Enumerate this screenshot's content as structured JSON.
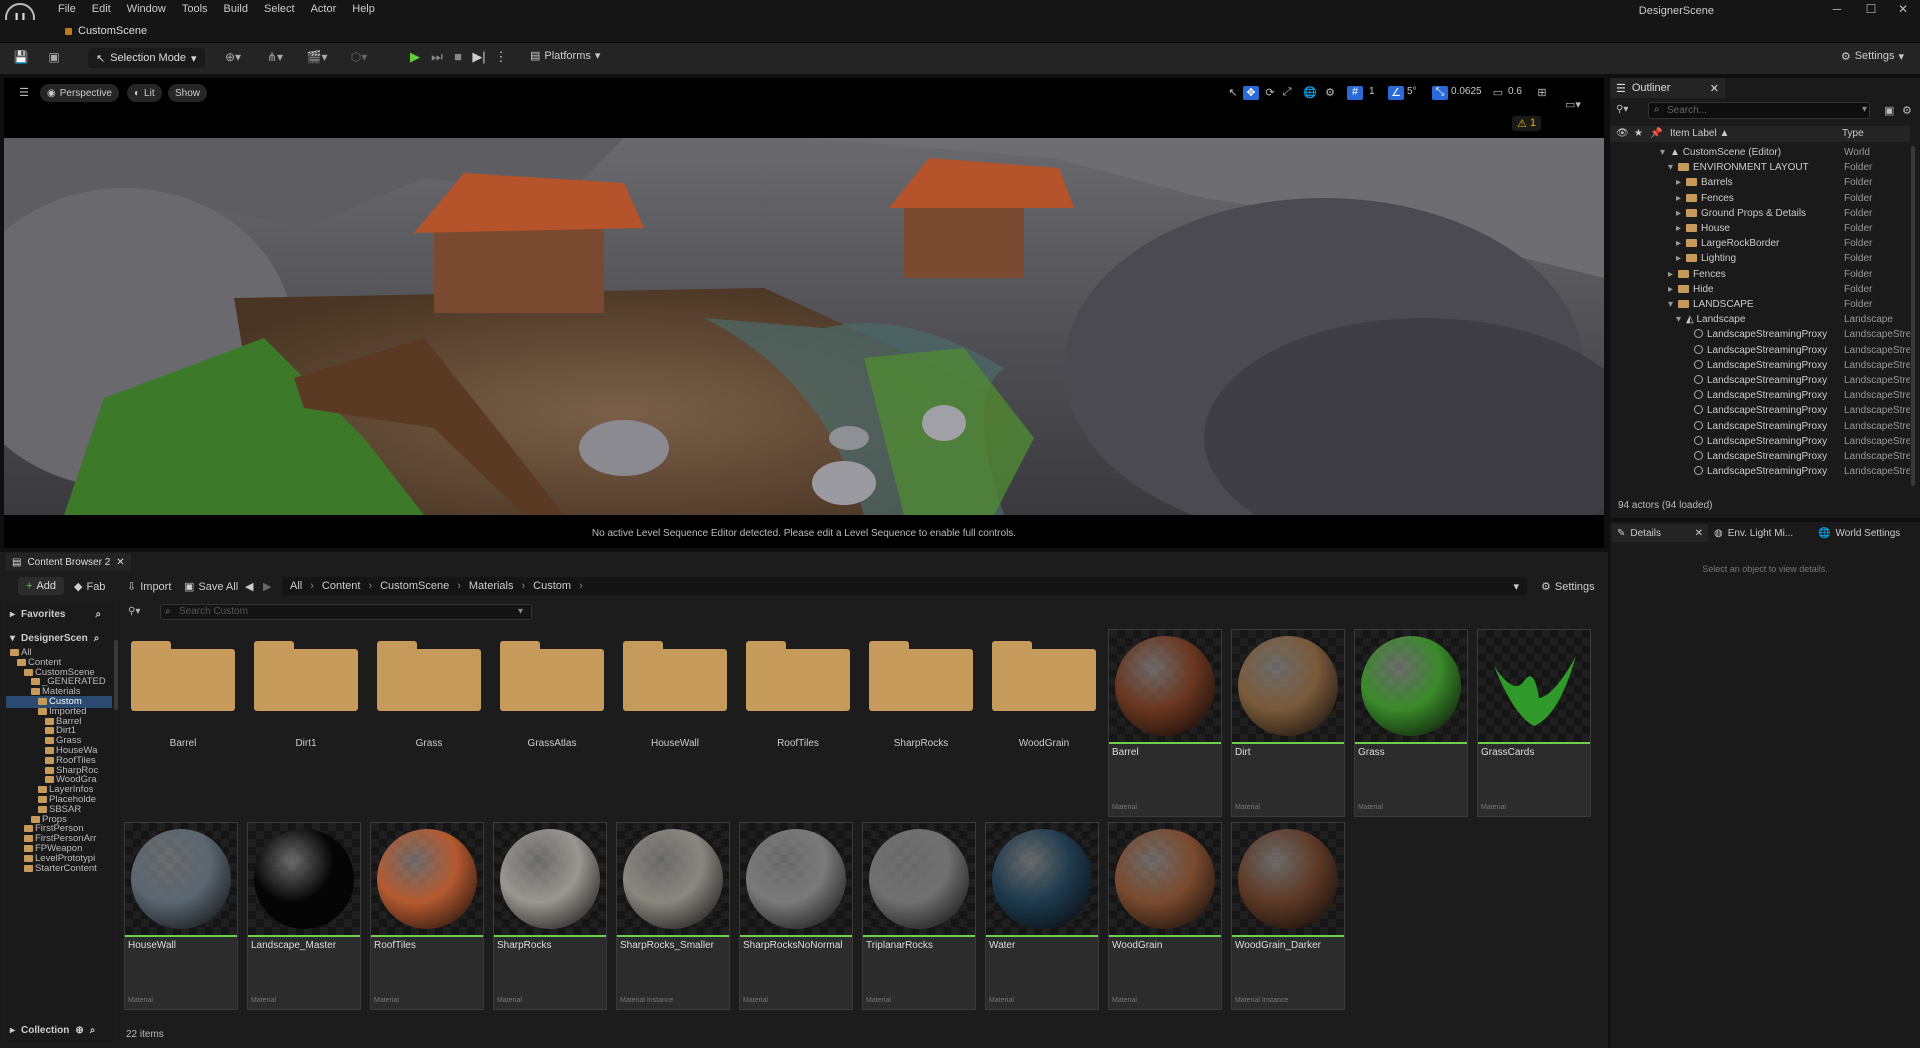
{
  "app": {
    "window_title": "DesignerScene",
    "doc_tab": "CustomScene",
    "menu": [
      "File",
      "Edit",
      "Window",
      "Tools",
      "Build",
      "Select",
      "Actor",
      "Help"
    ]
  },
  "toolbar": {
    "selection_mode": "Selection Mode",
    "platforms": "Platforms",
    "settings": "Settings"
  },
  "viewport": {
    "perspective": "Perspective",
    "lit": "Lit",
    "show": "Show",
    "grid_value": "1",
    "angle_value": "5°",
    "scale_value": "0.0625",
    "camera_speed": "0.6",
    "warning_count": "1",
    "sequence_message": "No active Level Sequence Editor detected. Please edit a Level Sequence to enable full controls."
  },
  "outliner": {
    "tab": "Outliner",
    "search_placeholder": "Search...",
    "col_label": "Item Label ▲",
    "col_type": "Type",
    "rows": [
      {
        "label": "CustomScene (Editor)",
        "type": "World",
        "indent": 0,
        "kind": "world"
      },
      {
        "label": "ENVIRONMENT LAYOUT",
        "type": "Folder",
        "indent": 1,
        "kind": "folder"
      },
      {
        "label": "Barrels",
        "type": "Folder",
        "indent": 2,
        "kind": "folder"
      },
      {
        "label": "Fences",
        "type": "Folder",
        "indent": 2,
        "kind": "folder"
      },
      {
        "label": "Ground Props & Details",
        "type": "Folder",
        "indent": 2,
        "kind": "folder"
      },
      {
        "label": "House",
        "type": "Folder",
        "indent": 2,
        "kind": "folder"
      },
      {
        "label": "LargeRockBorder",
        "type": "Folder",
        "indent": 2,
        "kind": "folder"
      },
      {
        "label": "Lighting",
        "type": "Folder",
        "indent": 2,
        "kind": "folder"
      },
      {
        "label": "Fences",
        "type": "Folder",
        "indent": 1,
        "kind": "folder"
      },
      {
        "label": "Hide",
        "type": "Folder",
        "indent": 1,
        "kind": "folder"
      },
      {
        "label": "LANDSCAPE",
        "type": "Folder",
        "indent": 1,
        "kind": "folder"
      },
      {
        "label": "Landscape",
        "type": "Landscape",
        "indent": 2,
        "kind": "landscape"
      },
      {
        "label": "LandscapeStreamingProxy",
        "type": "LandscapeStre",
        "indent": 3,
        "kind": "proxy"
      },
      {
        "label": "LandscapeStreamingProxy",
        "type": "LandscapeStre",
        "indent": 3,
        "kind": "proxy"
      },
      {
        "label": "LandscapeStreamingProxy",
        "type": "LandscapeStre",
        "indent": 3,
        "kind": "proxy"
      },
      {
        "label": "LandscapeStreamingProxy",
        "type": "LandscapeStre",
        "indent": 3,
        "kind": "proxy"
      },
      {
        "label": "LandscapeStreamingProxy",
        "type": "LandscapeStre",
        "indent": 3,
        "kind": "proxy"
      },
      {
        "label": "LandscapeStreamingProxy",
        "type": "LandscapeStre",
        "indent": 3,
        "kind": "proxy"
      },
      {
        "label": "LandscapeStreamingProxy",
        "type": "LandscapeStre",
        "indent": 3,
        "kind": "proxy"
      },
      {
        "label": "LandscapeStreamingProxy",
        "type": "LandscapeStre",
        "indent": 3,
        "kind": "proxy"
      },
      {
        "label": "LandscapeStreamingProxy",
        "type": "LandscapeStre",
        "indent": 3,
        "kind": "proxy"
      },
      {
        "label": "LandscapeStreamingProxy",
        "type": "LandscapeStre",
        "indent": 3,
        "kind": "proxy"
      }
    ],
    "actor_count": "94 actors (94 loaded)"
  },
  "details": {
    "tabs": [
      "Details",
      "Env. Light Mi...",
      "World Settings"
    ],
    "empty_message": "Select an object to view details."
  },
  "content_browser": {
    "tab": "Content Browser 2",
    "add": "Add",
    "fab": "Fab",
    "import": "Import",
    "save_all": "Save All",
    "settings": "Settings",
    "breadcrumb": [
      "All",
      "Content",
      "CustomScene",
      "Materials",
      "Custom"
    ],
    "search_placeholder": "Search Custom",
    "favorites": "Favorites",
    "project": "DesignerScen",
    "collection": "Collection",
    "item_count": "22 items",
    "tree": [
      {
        "label": "All",
        "indent": 0
      },
      {
        "label": "Content",
        "indent": 1
      },
      {
        "label": "CustomScene",
        "indent": 2
      },
      {
        "label": "_GENERATED",
        "indent": 3
      },
      {
        "label": "Materials",
        "indent": 3
      },
      {
        "label": "Custom",
        "indent": 4,
        "selected": true
      },
      {
        "label": "Imported",
        "indent": 4
      },
      {
        "label": "Barrel",
        "indent": 5
      },
      {
        "label": "Dirt1",
        "indent": 5
      },
      {
        "label": "Grass",
        "indent": 5
      },
      {
        "label": "HouseWa",
        "indent": 5
      },
      {
        "label": "RoofTiles",
        "indent": 5
      },
      {
        "label": "SharpRoc",
        "indent": 5
      },
      {
        "label": "WoodGra",
        "indent": 5
      },
      {
        "label": "LayerInfos",
        "indent": 4
      },
      {
        "label": "Placeholde",
        "indent": 4
      },
      {
        "label": "SBSAR",
        "indent": 4
      },
      {
        "label": "Props",
        "indent": 3
      },
      {
        "label": "FirstPerson",
        "indent": 2
      },
      {
        "label": "FirstPersonArr",
        "indent": 2
      },
      {
        "label": "FPWeapon",
        "indent": 2
      },
      {
        "label": "LevelPrototypi",
        "indent": 2
      },
      {
        "label": "StarterContent",
        "indent": 2
      }
    ],
    "folders": [
      "Barrel",
      "Dirt1",
      "Grass",
      "GrassAtlas",
      "HouseWall",
      "RoofTiles",
      "SharpRocks",
      "WoodGrain"
    ],
    "materials_row1": [
      {
        "name": "Barrel",
        "type": "Material",
        "color": "#6a3620"
      },
      {
        "name": "Dirt",
        "type": "Material",
        "color": "#7a5a3a"
      },
      {
        "name": "Grass",
        "type": "Material",
        "color": "#3a8a2a"
      },
      {
        "name": "GrassCards",
        "type": "Material",
        "color": "#2f9a2a"
      }
    ],
    "materials_row2": [
      {
        "name": "HouseWall",
        "type": "Material",
        "color": "#5a6670"
      },
      {
        "name": "Landscape_Master",
        "type": "Material",
        "color": "#050505"
      },
      {
        "name": "RoofTiles",
        "type": "Material",
        "color": "#b55a30"
      },
      {
        "name": "SharpRocks",
        "type": "Material",
        "color": "#9a9690"
      },
      {
        "name": "SharpRocks_Smaller",
        "type": "Material Instance",
        "color": "#8a877f"
      },
      {
        "name": "SharpRocksNoNormal",
        "type": "Material",
        "color": "#7a7a7a"
      },
      {
        "name": "TriplanarRocks",
        "type": "Material",
        "color": "#707070"
      },
      {
        "name": "Water",
        "type": "Material",
        "color": "#1e3a4e"
      },
      {
        "name": "WoodGrain",
        "type": "Material",
        "color": "#7a4a2e"
      },
      {
        "name": "WoodGrain_Darker",
        "type": "Material Instance",
        "color": "#5e3a26"
      }
    ]
  }
}
